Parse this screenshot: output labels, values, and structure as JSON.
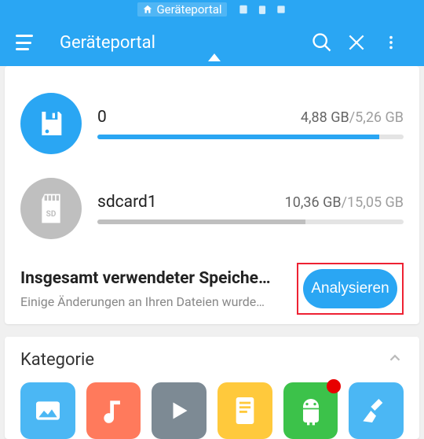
{
  "status": {
    "title": "Geräteportal"
  },
  "toolbar": {
    "title": "Geräteportal"
  },
  "storage": [
    {
      "name": "0",
      "used": "4,88 GB",
      "total": "5,26 GB",
      "pct": 92,
      "style": "blue"
    },
    {
      "name": "sdcard1",
      "used": "10,36 GB",
      "total": "15,05 GB",
      "pct": 68,
      "style": "gray"
    }
  ],
  "summary": {
    "title": "Insgesamt verwendeter Speiche…",
    "subtitle": "Einige Änderungen an Ihren Dateien wurde…",
    "analyze": "Analysieren"
  },
  "category": {
    "title": "Kategorie"
  },
  "colors": {
    "accent": "#2aa6f3",
    "images": "#4bb7f4",
    "music": "#ff7a5c",
    "video": "#7d8a94",
    "docs": "#ffc93c",
    "apps": "#3cc24a",
    "clean": "#4bb7f4"
  }
}
